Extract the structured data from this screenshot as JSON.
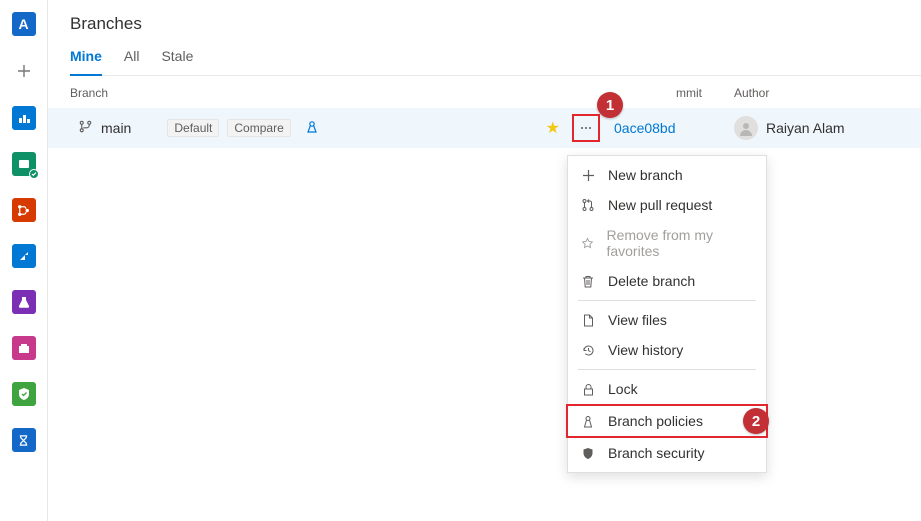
{
  "page_title": "Branches",
  "tabs": {
    "mine": "Mine",
    "all": "All",
    "stale": "Stale"
  },
  "columns": {
    "branch": "Branch",
    "commit": "mmit",
    "author": "Author"
  },
  "branch": {
    "name": "main",
    "default_tag": "Default",
    "compare_tag": "Compare",
    "commit": "0ace08bd",
    "author": "Raiyan Alam"
  },
  "menu": {
    "new_branch": "New branch",
    "new_pr": "New pull request",
    "remove_fav": "Remove from my favorites",
    "delete": "Delete branch",
    "view_files": "View files",
    "view_history": "View history",
    "lock": "Lock",
    "policies": "Branch policies",
    "security": "Branch security"
  },
  "callouts": {
    "one": "1",
    "two": "2"
  }
}
